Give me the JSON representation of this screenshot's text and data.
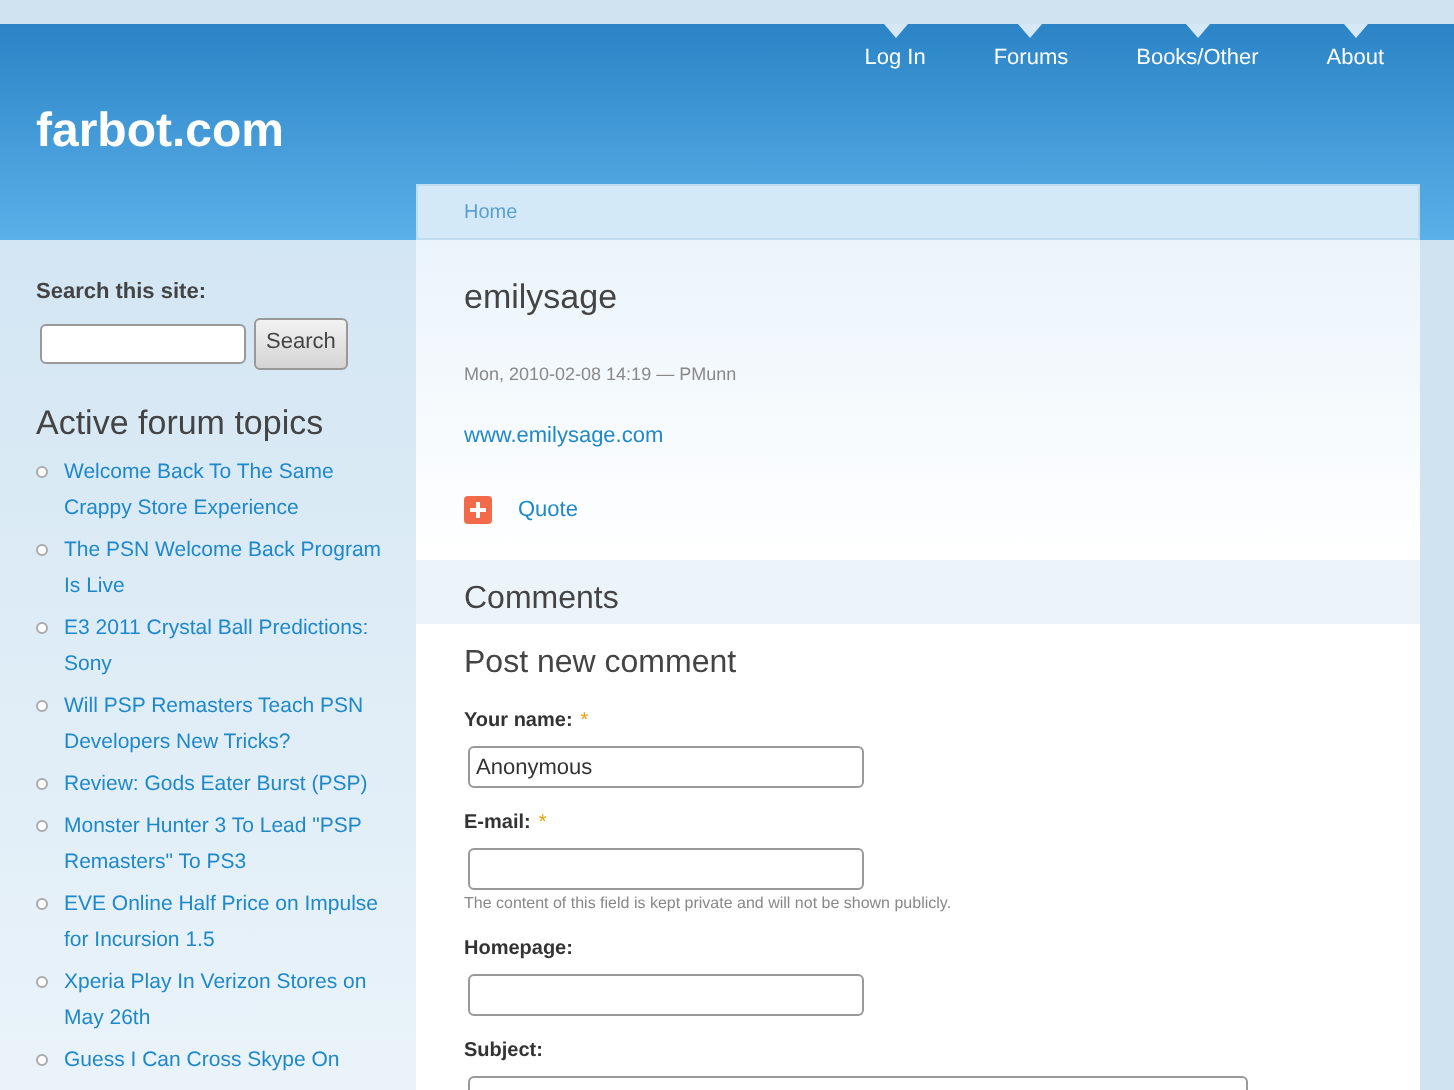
{
  "nav": [
    "Log In",
    "Forums",
    "Books/Other",
    "About"
  ],
  "site_name": "farbot.com",
  "search": {
    "label": "Search this site:",
    "button": "Search"
  },
  "forum_topics": {
    "title": "Active forum topics",
    "items": [
      "Welcome Back To The Same Crappy Store Experience",
      "The PSN Welcome Back Program Is Live",
      "E3 2011 Crystal Ball Predictions: Sony",
      "Will PSP Remasters Teach PSN Developers New Tricks?",
      "Review: Gods Eater Burst (PSP)",
      "Monster Hunter 3 To Lead \"PSP Remasters\" To PS3",
      "EVE Online Half Price on Impulse for Incursion 1.5",
      "Xperia Play In Verizon Stores on May 26th",
      "Guess I Can Cross Skype On"
    ]
  },
  "breadcrumb": "Home",
  "node": {
    "title": "emilysage",
    "meta": "Mon, 2010-02-08 14:19 — PMunn",
    "link": "www.emilysage.com",
    "quote": "Quote"
  },
  "comments": {
    "title": "Comments",
    "form_title": "Post new comment",
    "fields": [
      {
        "label": "Your name:",
        "required_mark": "*",
        "value": "Anonymous",
        "wide": false
      },
      {
        "label": "E-mail:",
        "required_mark": "*",
        "description": "The content of this field is kept private and will not be shown publicly.",
        "wide": false
      },
      {
        "label": "Homepage:",
        "wide": false
      },
      {
        "label": "Subject:",
        "wide": true
      }
    ]
  }
}
